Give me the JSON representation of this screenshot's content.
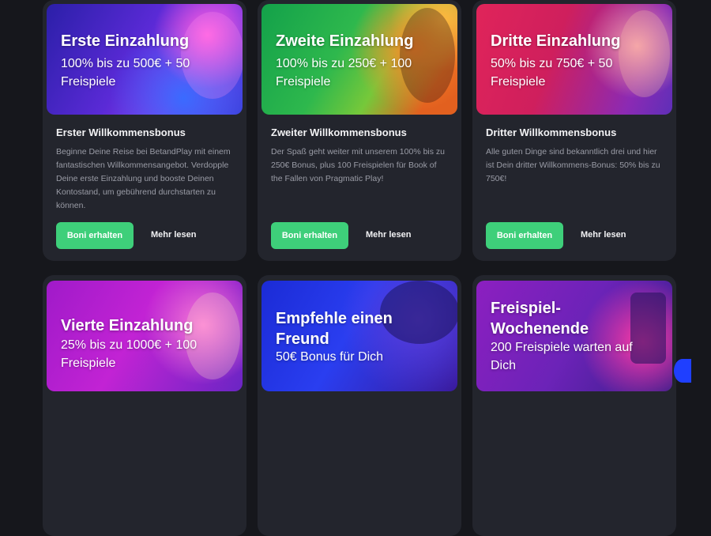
{
  "cards": [
    {
      "banner_title": "Erste Einzahlung",
      "banner_subtitle": "100% bis zu 500€ + 50 Freispiele",
      "title": "Erster Willkommensbonus",
      "description": "Beginne Deine Reise bei BetandPlay mit einem fantastischen Willkommensangebot. Verdopple Deine erste Einzahlung und booste Deinen Kontostand, um gebührend durchstarten zu können.",
      "cta_label": "Boni erhalten",
      "more_label": "Mehr lesen"
    },
    {
      "banner_title": "Zweite Einzahlung",
      "banner_subtitle": "100% bis zu 250€ + 100 Freispiele",
      "title": "Zweiter Willkommensbonus",
      "description": "Der Spaß geht weiter mit unserem 100% bis zu 250€ Bonus, plus 100 Freispielen für Book of the Fallen von Pragmatic Play!",
      "cta_label": "Boni erhalten",
      "more_label": "Mehr lesen"
    },
    {
      "banner_title": "Dritte Einzahlung",
      "banner_subtitle": "50% bis zu 750€ + 50 Freispiele",
      "title": "Dritter Willkommensbonus",
      "description": "Alle guten Dinge sind bekanntlich drei und hier ist Dein dritter Willkommens-Bonus: 50% bis zu 750€!",
      "cta_label": "Boni erhalten",
      "more_label": "Mehr lesen"
    },
    {
      "banner_title": "Vierte Einzahlung",
      "banner_subtitle": "25% bis zu 1000€ + 100 Freispiele"
    },
    {
      "banner_title": "Empfehle einen Freund",
      "banner_subtitle": "50€ Bonus für Dich"
    },
    {
      "banner_title": "Freispiel-Wochenende",
      "banner_subtitle": "200 Freispiele warten auf Dich"
    }
  ]
}
